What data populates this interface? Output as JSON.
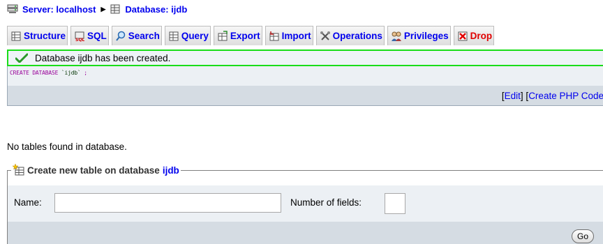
{
  "breadcrumb": {
    "server_label": "Server: localhost",
    "database_label": "Database: ijdb",
    "separator": "▶"
  },
  "tabs": [
    {
      "label": "Structure",
      "icon": "structure-icon"
    },
    {
      "label": "SQL",
      "icon": "sql-icon"
    },
    {
      "label": "Search",
      "icon": "search-icon"
    },
    {
      "label": "Query",
      "icon": "query-icon"
    },
    {
      "label": "Export",
      "icon": "export-icon"
    },
    {
      "label": "Import",
      "icon": "import-icon"
    },
    {
      "label": "Operations",
      "icon": "operations-icon"
    },
    {
      "label": "Privileges",
      "icon": "privileges-icon"
    },
    {
      "label": "Drop",
      "icon": "drop-icon"
    }
  ],
  "notice": {
    "message": "Database ijdb has been created.",
    "icon": "checkmark-icon"
  },
  "sql": {
    "keyword": "CREATE DATABASE",
    "name": "`ijdb`",
    "terminator": ";",
    "edit_open": "[ ",
    "edit_label": "Edit",
    "edit_close": " ] [ ",
    "php_label": "Create PHP Code"
  },
  "status": {
    "no_tables": "No tables found in database."
  },
  "create_table": {
    "legend_prefix": "Create new table on database",
    "legend_db": "ijdb",
    "name_label": "Name:",
    "name_value": "",
    "fields_label": "Number of fields:",
    "fields_value": "",
    "go_label": "Go"
  },
  "colors": {
    "link": "#0000ee",
    "notice_border": "#19dd19",
    "sql_keyword": "#990099",
    "drop_tab": "#e00000"
  }
}
